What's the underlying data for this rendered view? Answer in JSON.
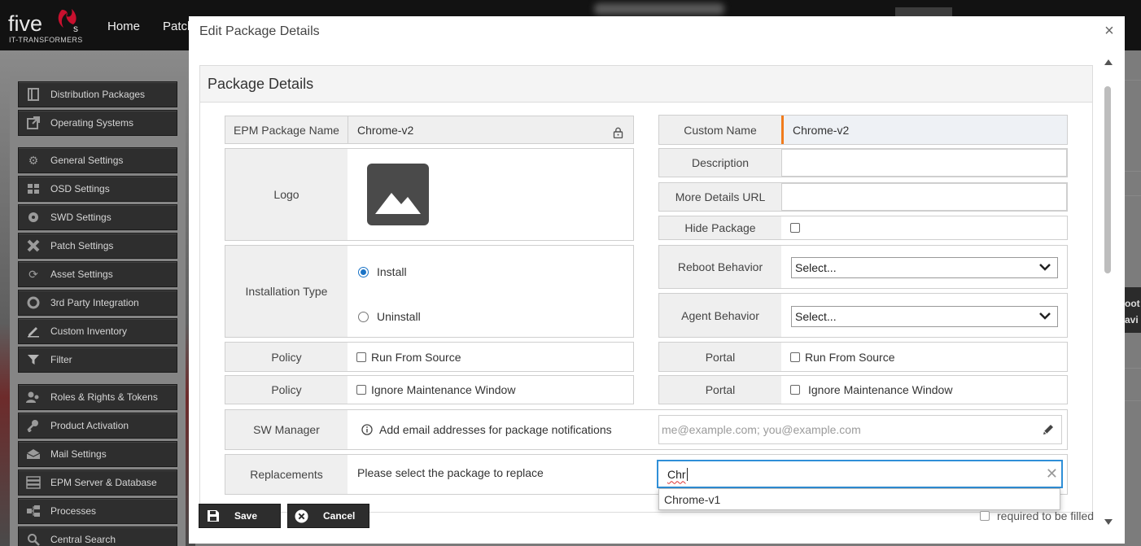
{
  "app": {
    "logo_word": "five",
    "logo_suffix": "s",
    "logo_tagline": "IT-TRANSFORMERS",
    "nav": [
      "Home",
      "Patch"
    ],
    "side_right_text": "oot avi"
  },
  "sidebar": {
    "items": [
      {
        "label": "Distribution Packages",
        "icon": "package-icon"
      },
      {
        "label": "Operating Systems",
        "icon": "external-link-icon"
      },
      {
        "label": "General Settings",
        "icon": "gear-icon"
      },
      {
        "label": "OSD Settings",
        "icon": "windows-icon"
      },
      {
        "label": "SWD Settings",
        "icon": "software-icon"
      },
      {
        "label": "Patch Settings",
        "icon": "patch-icon"
      },
      {
        "label": "Asset Settings",
        "icon": "refresh-icon"
      },
      {
        "label": "3rd Party Integration",
        "icon": "integration-icon"
      },
      {
        "label": "Custom Inventory",
        "icon": "edit-icon"
      },
      {
        "label": "Filter",
        "icon": "filter-icon"
      },
      {
        "label": "Roles & Rights & Tokens",
        "icon": "users-icon"
      },
      {
        "label": "Product Activation",
        "icon": "key-icon"
      },
      {
        "label": "Mail Settings",
        "icon": "mail-icon"
      },
      {
        "label": "EPM Server & Database",
        "icon": "server-icon"
      },
      {
        "label": "Processes",
        "icon": "processes-icon"
      },
      {
        "label": "Central Search",
        "icon": "search-icon"
      }
    ]
  },
  "modal": {
    "title": "Edit Package Details",
    "close": "×",
    "panel_title": "Package Details",
    "left": {
      "epm_name_label": "EPM Package Name",
      "epm_name_value": "Chrome-v2",
      "logo_label": "Logo",
      "install_type_label": "Installation Type",
      "install_option": "Install",
      "uninstall_option": "Uninstall",
      "install_selected": "Install",
      "policy1_label": "Policy",
      "policy1_option": "Run From Source",
      "policy2_label": "Policy",
      "policy2_option": "Ignore Maintenance Window"
    },
    "right": {
      "custom_name_label": "Custom Name",
      "custom_name_value": "Chrome-v2",
      "description_label": "Description",
      "description_value": "",
      "more_url_label": "More Details URL",
      "more_url_value": "",
      "hide_label": "Hide Package",
      "hide_checked": false,
      "reboot_label": "Reboot Behavior",
      "reboot_value": "Select...",
      "agent_label": "Agent Behavior",
      "agent_value": "Select...",
      "portal1_label": "Portal",
      "portal1_option": "Run From Source",
      "portal2_label": "Portal",
      "portal2_option": "Ignore Maintenance Window"
    },
    "sw_manager": {
      "label": "SW Manager",
      "info": "Add email addresses for package notifications",
      "placeholder": "me@example.com; you@example.com"
    },
    "replacements": {
      "label": "Replacements",
      "hint": "Please select the package to replace",
      "typed": "Chr",
      "suggestion": "Chrome-v1"
    },
    "footer": {
      "save": "Save",
      "cancel": "Cancel",
      "required_note": "required to be filled"
    }
  },
  "colors": {
    "accent_orange": "#f07b1d",
    "radio_blue": "#1a73c6",
    "focus_blue": "#2f8fd8",
    "dark_button": "#2d2d2d"
  }
}
